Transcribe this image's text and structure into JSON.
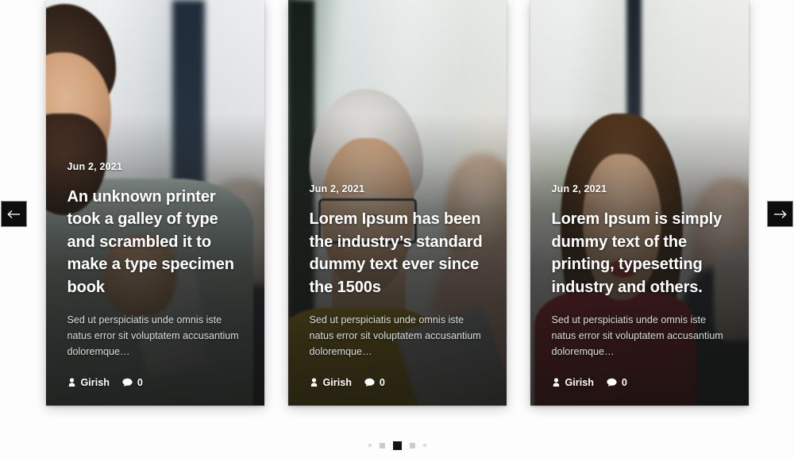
{
  "carousel": {
    "prev_label": "←",
    "next_label": "→",
    "prev_name": "previous-slide",
    "next_name": "next-slide",
    "active_slide": 3,
    "total_dots": 5,
    "dots": [
      "1",
      "2",
      "3",
      "4",
      "5"
    ],
    "accent_dark": "#0d0d0d",
    "dot_active_color": "#141414",
    "dot_inactive_color": "#d6d6d6",
    "page_background": "#fdfdfd"
  },
  "cards": [
    {
      "date": "Jun 2, 2021",
      "title": "An unknown printer took a galley of type and scrambled it to make a type specimen book",
      "excerpt": "Sed ut perspiciatis unde omnis iste natus error sit voluptatem accusantium doloremque…",
      "author": "Girish",
      "comments": "0",
      "author_icon": "user-icon",
      "comment_icon": "comment-icon",
      "image_alt": "smiling bearded man in sage shirt looking at phone"
    },
    {
      "date": "Jun 2, 2021",
      "title": "Lorem Ipsum has been the industry’s standard dummy text ever since the 1500s",
      "excerpt": "Sed ut perspiciatis unde omnis iste natus error sit voluptatem accusantium doloremque…",
      "author": "Girish",
      "comments": "0",
      "author_icon": "user-icon",
      "comment_icon": "comment-icon",
      "image_alt": "smiling woman with short silver hair, glasses and mustard turtleneck"
    },
    {
      "date": "Jun 2, 2021",
      "title": "Lorem Ipsum is simply dummy text of the printing, typesetting industry and others.",
      "excerpt": "Sed ut perspiciatis unde omnis iste natus error sit voluptatem accusantium doloremque…",
      "author": "Girish",
      "comments": "0",
      "author_icon": "user-icon",
      "comment_icon": "comment-icon",
      "image_alt": "smiling woman with long brown hair in red top"
    }
  ]
}
